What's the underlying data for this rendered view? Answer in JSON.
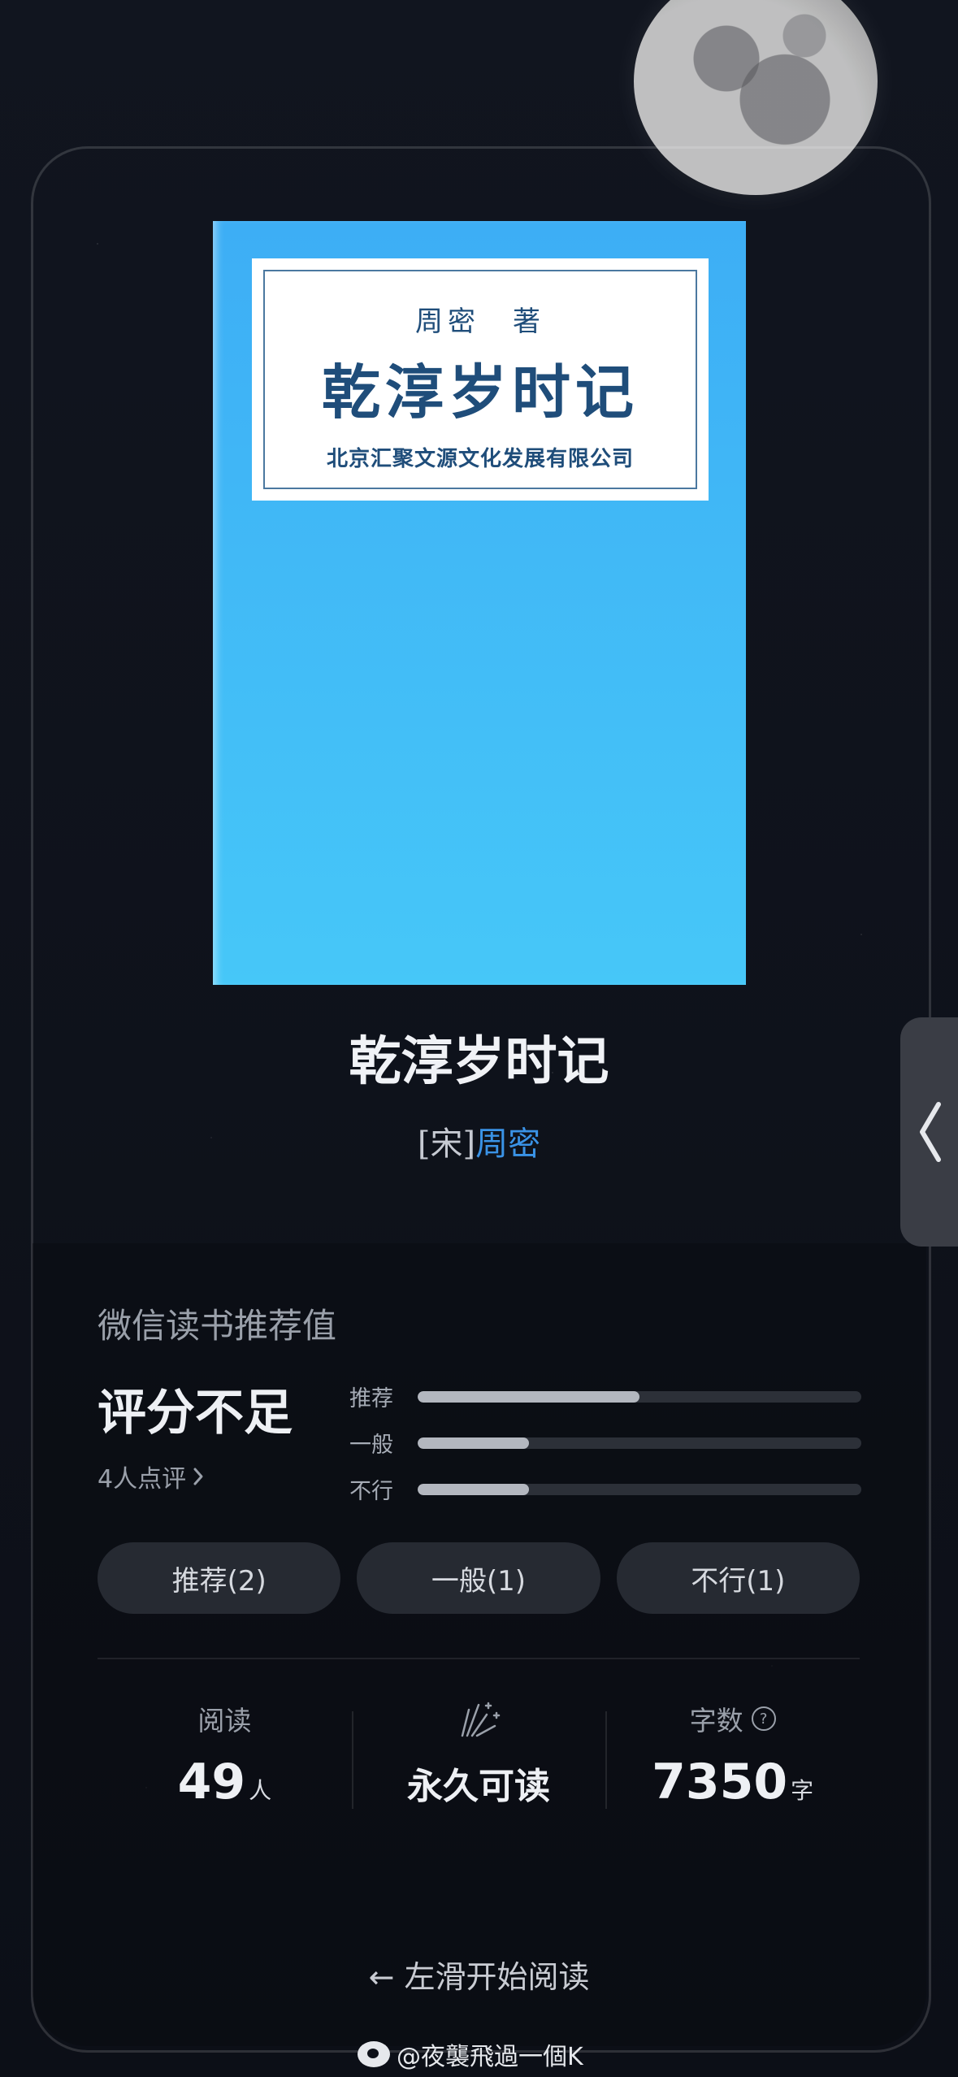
{
  "cover": {
    "author": "周密　著",
    "title": "乾淳岁时记",
    "publisher": "北京汇聚文源文化发展有限公司"
  },
  "book": {
    "title": "乾淳岁时记",
    "dynasty": "[宋]",
    "author": "周密"
  },
  "recommendation": {
    "section_title": "微信读书推荐值",
    "score_text": "评分不足",
    "raters_text": "4人点评",
    "bars": [
      {
        "label": "推荐",
        "fraction": 0.5
      },
      {
        "label": "一般",
        "fraction": 0.25
      },
      {
        "label": "不行",
        "fraction": 0.25
      }
    ],
    "buttons": {
      "recommend": "推荐(2)",
      "average": "一般(1)",
      "bad": "不行(1)"
    }
  },
  "stats": {
    "read_label": "阅读",
    "read_count": "49",
    "read_unit": "人",
    "permanent_text": "永久可读",
    "word_label": "字数",
    "word_count": "7350",
    "word_unit": "字"
  },
  "swipe_hint": "← 左滑开始阅读",
  "watermark": "@夜襲飛過一個K",
  "icons": {
    "side_tab": "chevron-left-icon",
    "fireworks": "sparkle-icon",
    "help": "question-circle-icon",
    "watermark_logo": "weibo-icon"
  },
  "colors": {
    "cover_blue": "#3daef5",
    "author_link": "#3a93e6",
    "background": "#0e1119"
  }
}
